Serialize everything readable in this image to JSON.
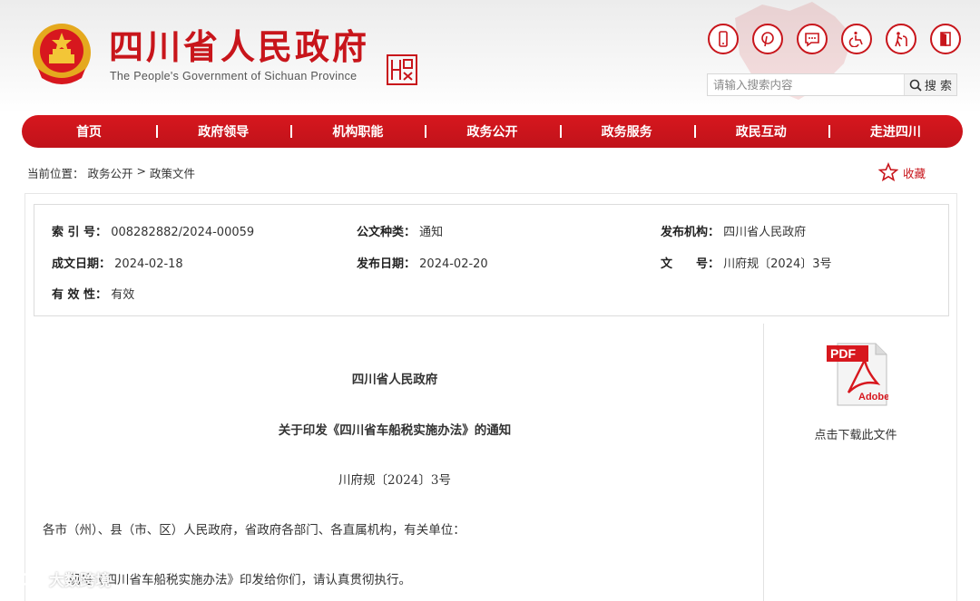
{
  "header": {
    "site_title": "四川省人民政府",
    "site_subtitle": "The People's Government of Sichuan Province",
    "search_placeholder": "请输入搜索内容",
    "search_button": "搜 索",
    "tool_icons": [
      "mobile-icon",
      "pinterest-icon",
      "chat-icon",
      "accessibility-icon",
      "elderly-mode-icon",
      "exit-icon"
    ],
    "brand_color": "#c8151b"
  },
  "nav": {
    "items": [
      "首页",
      "政府领导",
      "机构职能",
      "政务公开",
      "政务服务",
      "政民互动",
      "走进四川"
    ]
  },
  "breadcrumb": {
    "prefix": "当前位置：",
    "items": [
      "政务公开",
      "政策文件"
    ],
    "separator": ">"
  },
  "favorite": {
    "label": "收藏"
  },
  "meta": {
    "index_label": "索 引 号：",
    "index_value": "008282882/2024-00059",
    "type_label": "公文种类：",
    "type_value": "通知",
    "publisher_label": "发布机构：",
    "publisher_value": "四川省人民政府",
    "created_label": "成文日期：",
    "created_value": "2024-02-18",
    "published_label": "发布日期：",
    "published_value": "2024-02-20",
    "docno_label": "文　　号：",
    "docno_value": "川府规〔2024〕3号",
    "validity_label": "有 效 性：",
    "validity_value": "有效"
  },
  "document": {
    "issuer": "四川省人民政府",
    "title": "关于印发《四川省车船税实施办法》的通知",
    "doc_number": "川府规〔2024〕3号",
    "salutation": "各市（州）、县（市、区）人民政府，省政府各部门、各直属机构，有关单位：",
    "body_line": "现将《四川省车船税实施办法》印发给你们，请认真贯彻执行。"
  },
  "download": {
    "pdf_badge": "PDF",
    "adobe_label": "Adobe",
    "label": "点击下载此文件"
  },
  "watermark": {
    "text": "大数跨境"
  }
}
